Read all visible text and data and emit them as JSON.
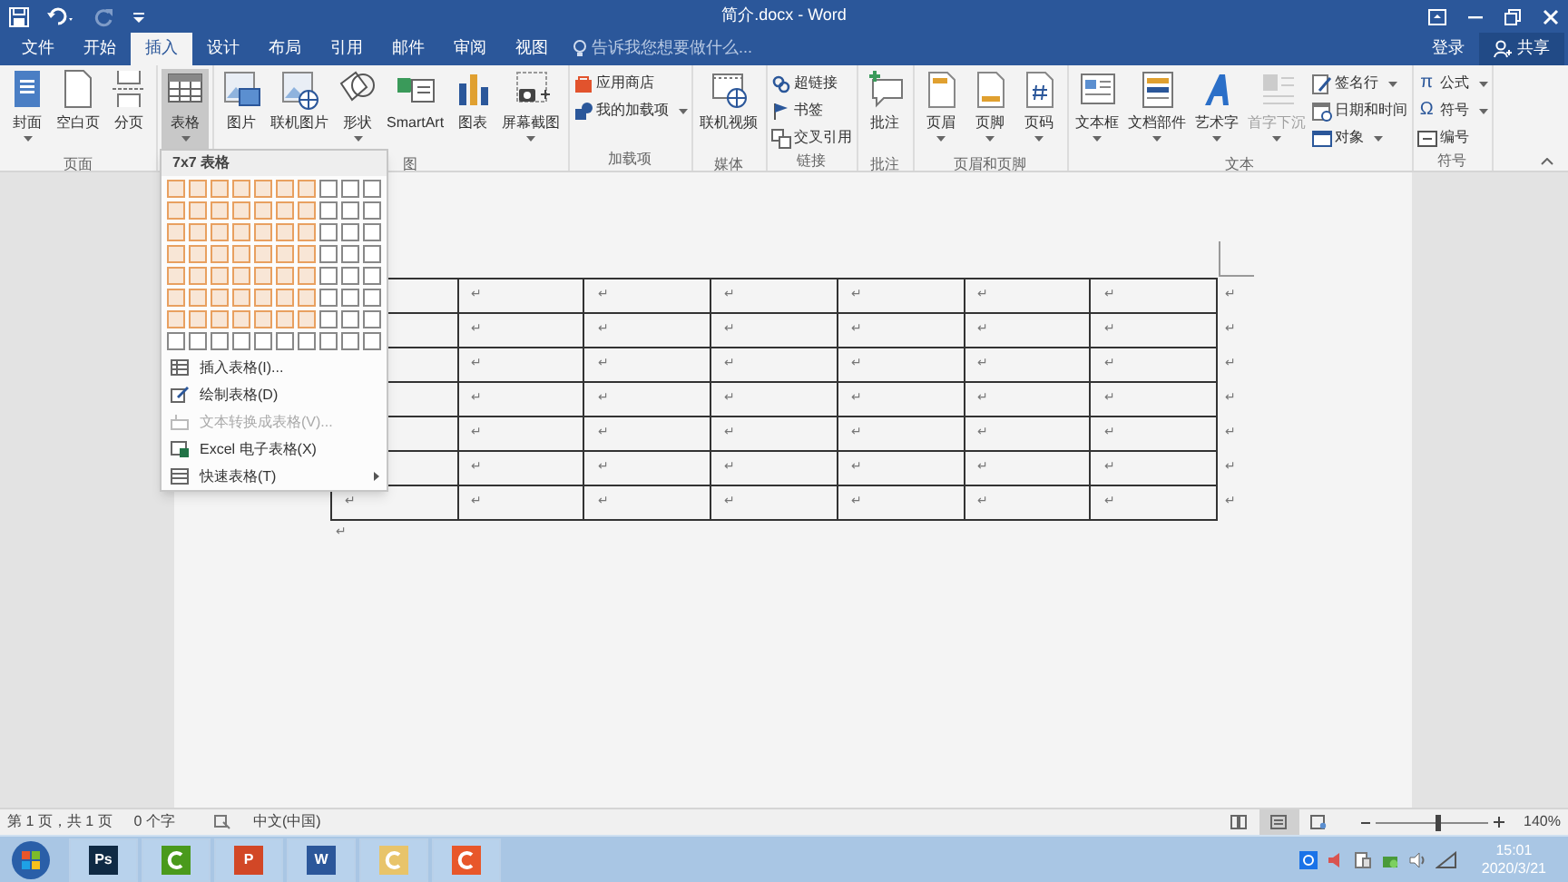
{
  "window": {
    "title": "简介.docx - Word"
  },
  "quick_access": [
    {
      "kind": "save",
      "disabled": false
    },
    {
      "kind": "undo",
      "disabled": false
    },
    {
      "kind": "redo",
      "disabled": true
    },
    {
      "kind": "customize",
      "disabled": false
    }
  ],
  "tabs": [
    {
      "label": "文件",
      "selected": false
    },
    {
      "label": "开始",
      "selected": false
    },
    {
      "label": "插入",
      "selected": true
    },
    {
      "label": "设计",
      "selected": false
    },
    {
      "label": "布局",
      "selected": false
    },
    {
      "label": "引用",
      "selected": false
    },
    {
      "label": "邮件",
      "selected": false
    },
    {
      "label": "审阅",
      "selected": false
    },
    {
      "label": "视图",
      "selected": false
    }
  ],
  "tell_me": {
    "placeholder": "告诉我您想要做什么..."
  },
  "account": {
    "sign_in": "登录",
    "share": "共享"
  },
  "ribbon": {
    "groups": [
      {
        "label": "页面",
        "buttons": [
          {
            "kind": "large",
            "label": "封面",
            "dropdown": true,
            "disabled": false,
            "selected": false
          },
          {
            "kind": "large",
            "label": "空白页",
            "dropdown": false,
            "disabled": false,
            "selected": false
          },
          {
            "kind": "large",
            "label": "分页",
            "dropdown": false,
            "disabled": false,
            "selected": false
          }
        ]
      },
      {
        "buttons": [
          {
            "kind": "large",
            "label": "表格",
            "dropdown": true,
            "disabled": false,
            "selected": true
          }
        ]
      },
      {
        "label": "图",
        "buttons": [
          {
            "kind": "large",
            "label": "图片",
            "dropdown": false,
            "disabled": false,
            "selected": false
          },
          {
            "kind": "large",
            "label": "联机图片",
            "dropdown": false,
            "disabled": false,
            "selected": false
          },
          {
            "kind": "large",
            "label": "形状",
            "dropdown": true,
            "disabled": false,
            "selected": false
          },
          {
            "kind": "large",
            "label": "SmartArt",
            "dropdown": false,
            "disabled": false,
            "selected": false
          },
          {
            "kind": "large",
            "label": "图表",
            "dropdown": false,
            "disabled": false,
            "selected": false
          },
          {
            "kind": "large",
            "label": "屏幕截图",
            "dropdown": true,
            "disabled": false,
            "selected": false
          }
        ]
      },
      {
        "label": "加载项",
        "buttons": [
          {
            "kind": "small",
            "label": "应用商店",
            "dropdown": false,
            "disabled": false,
            "selected": false
          },
          {
            "kind": "small",
            "label": "我的加载项",
            "dropdown": true,
            "disabled": false,
            "selected": false
          }
        ]
      },
      {
        "label": "媒体",
        "buttons": [
          {
            "kind": "large",
            "label": "联机视频",
            "dropdown": false,
            "disabled": false,
            "selected": false
          }
        ]
      },
      {
        "label": "链接",
        "buttons": [
          {
            "kind": "small",
            "label": "超链接",
            "dropdown": false,
            "disabled": false,
            "selected": false
          },
          {
            "kind": "small",
            "label": "书签",
            "dropdown": false,
            "disabled": false,
            "selected": false
          },
          {
            "kind": "small",
            "label": "交叉引用",
            "dropdown": false,
            "disabled": false,
            "selected": false
          }
        ]
      },
      {
        "label": "批注",
        "buttons": [
          {
            "kind": "large",
            "label": "批注",
            "dropdown": false,
            "disabled": false,
            "selected": false
          }
        ]
      },
      {
        "label": "页眉和页脚",
        "buttons": [
          {
            "kind": "large",
            "label": "页眉",
            "dropdown": true,
            "disabled": false,
            "selected": false
          },
          {
            "kind": "large",
            "label": "页脚",
            "dropdown": true,
            "disabled": false,
            "selected": false
          },
          {
            "kind": "large",
            "label": "页码",
            "dropdown": true,
            "disabled": false,
            "selected": false
          }
        ]
      },
      {
        "label": "文本",
        "buttons": [
          {
            "kind": "large",
            "label": "文本框",
            "dropdown": true,
            "disabled": false,
            "selected": false
          },
          {
            "kind": "large",
            "label": "文档部件",
            "dropdown": true,
            "disabled": false,
            "selected": false
          },
          {
            "kind": "large",
            "label": "艺术字",
            "dropdown": true,
            "disabled": false,
            "selected": false
          },
          {
            "kind": "large",
            "label": "首字下沉",
            "dropdown": true,
            "disabled": true,
            "selected": false
          },
          {
            "kind": "small",
            "label": "签名行",
            "dropdown": true,
            "disabled": false,
            "selected": false
          },
          {
            "kind": "small",
            "label": "日期和时间",
            "dropdown": false,
            "disabled": false,
            "selected": false
          },
          {
            "kind": "small",
            "label": "对象",
            "dropdown": true,
            "disabled": false,
            "selected": false
          }
        ]
      },
      {
        "label": "符号",
        "buttons": [
          {
            "kind": "small",
            "label": "公式",
            "glyph": "π",
            "dropdown": true,
            "disabled": false,
            "selected": false
          },
          {
            "kind": "small",
            "label": "符号",
            "glyph": "Ω",
            "dropdown": true,
            "disabled": false,
            "selected": false
          },
          {
            "kind": "small",
            "label": "编号",
            "dropdown": false,
            "disabled": false,
            "selected": false
          }
        ]
      }
    ]
  },
  "table_menu": {
    "header": "7x7 表格",
    "grid": [
      [
        {
          "selected": true
        },
        {
          "selected": true
        },
        {
          "selected": true
        },
        {
          "selected": true
        },
        {
          "selected": true
        },
        {
          "selected": true
        },
        {
          "selected": true
        },
        {
          "selected": false
        },
        {
          "selected": false
        },
        {
          "selected": false
        }
      ],
      [
        {
          "selected": true
        },
        {
          "selected": true
        },
        {
          "selected": true
        },
        {
          "selected": true
        },
        {
          "selected": true
        },
        {
          "selected": true
        },
        {
          "selected": true
        },
        {
          "selected": false
        },
        {
          "selected": false
        },
        {
          "selected": false
        }
      ],
      [
        {
          "selected": true
        },
        {
          "selected": true
        },
        {
          "selected": true
        },
        {
          "selected": true
        },
        {
          "selected": true
        },
        {
          "selected": true
        },
        {
          "selected": true
        },
        {
          "selected": false
        },
        {
          "selected": false
        },
        {
          "selected": false
        }
      ],
      [
        {
          "selected": true
        },
        {
          "selected": true
        },
        {
          "selected": true
        },
        {
          "selected": true
        },
        {
          "selected": true
        },
        {
          "selected": true
        },
        {
          "selected": true
        },
        {
          "selected": false
        },
        {
          "selected": false
        },
        {
          "selected": false
        }
      ],
      [
        {
          "selected": true
        },
        {
          "selected": true
        },
        {
          "selected": true
        },
        {
          "selected": true
        },
        {
          "selected": true
        },
        {
          "selected": true
        },
        {
          "selected": true
        },
        {
          "selected": false
        },
        {
          "selected": false
        },
        {
          "selected": false
        }
      ],
      [
        {
          "selected": true
        },
        {
          "selected": true
        },
        {
          "selected": true
        },
        {
          "selected": true
        },
        {
          "selected": true
        },
        {
          "selected": true
        },
        {
          "selected": true
        },
        {
          "selected": false
        },
        {
          "selected": false
        },
        {
          "selected": false
        }
      ],
      [
        {
          "selected": true
        },
        {
          "selected": true
        },
        {
          "selected": true
        },
        {
          "selected": true
        },
        {
          "selected": true
        },
        {
          "selected": true
        },
        {
          "selected": true
        },
        {
          "selected": false
        },
        {
          "selected": false
        },
        {
          "selected": false
        }
      ],
      [
        {
          "selected": false
        },
        {
          "selected": false
        },
        {
          "selected": false
        },
        {
          "selected": false
        },
        {
          "selected": false
        },
        {
          "selected": false
        },
        {
          "selected": false
        },
        {
          "selected": false
        },
        {
          "selected": false
        },
        {
          "selected": false
        }
      ]
    ],
    "items": [
      {
        "label": "插入表格(I)...",
        "disabled": false,
        "submenu": false
      },
      {
        "label": "绘制表格(D)",
        "disabled": false,
        "submenu": false
      },
      {
        "label": "文本转换成表格(V)...",
        "disabled": true,
        "submenu": false
      },
      {
        "label": "Excel 电子表格(X)",
        "disabled": false,
        "submenu": false
      },
      {
        "label": "快速表格(T)",
        "disabled": false,
        "submenu": true
      }
    ]
  },
  "document": {
    "table": {
      "rows": [
        {
          "cells": [
            "",
            "↵",
            "↵",
            "↵",
            "↵",
            "↵",
            "↵"
          ],
          "end_mark": "↵"
        },
        {
          "cells": [
            "",
            "↵",
            "↵",
            "↵",
            "↵",
            "↵",
            "↵"
          ],
          "end_mark": "↵"
        },
        {
          "cells": [
            "",
            "↵",
            "↵",
            "↵",
            "↵",
            "↵",
            "↵"
          ],
          "end_mark": "↵"
        },
        {
          "cells": [
            "",
            "↵",
            "↵",
            "↵",
            "↵",
            "↵",
            "↵"
          ],
          "end_mark": "↵"
        },
        {
          "cells": [
            "",
            "↵",
            "↵",
            "↵",
            "↵",
            "↵",
            "↵"
          ],
          "end_mark": "↵"
        },
        {
          "cells": [
            "",
            "↵",
            "↵",
            "↵",
            "↵",
            "↵",
            "↵"
          ],
          "end_mark": "↵"
        },
        {
          "cells": [
            "↵",
            "↵",
            "↵",
            "↵",
            "↵",
            "↵",
            "↵"
          ],
          "end_mark": "↵"
        }
      ]
    },
    "after_table_mark": "↵"
  },
  "status_bar": {
    "page": "第 1 页，共 1 页",
    "words": "0 个字",
    "language": "中文(中国)",
    "views": [
      {
        "kind": "read",
        "selected": false
      },
      {
        "kind": "print",
        "selected": true
      },
      {
        "kind": "web",
        "selected": false
      }
    ],
    "zoom": {
      "level": 0.57,
      "reading": "140%"
    }
  },
  "taskbar": {
    "apps": [
      {
        "label": "Ps",
        "color": "#0f2a44",
        "selected": false
      },
      {
        "color": "#4a9a1c",
        "selected": false
      },
      {
        "label": "P",
        "color": "#d24726",
        "selected": false
      },
      {
        "label": "W",
        "color": "#2b579a",
        "selected": false
      },
      {
        "color": "#e8c46a",
        "selected": false
      },
      {
        "color": "#e8572a",
        "selected": false
      }
    ],
    "time": "15:01",
    "date": "2020/3/21"
  }
}
